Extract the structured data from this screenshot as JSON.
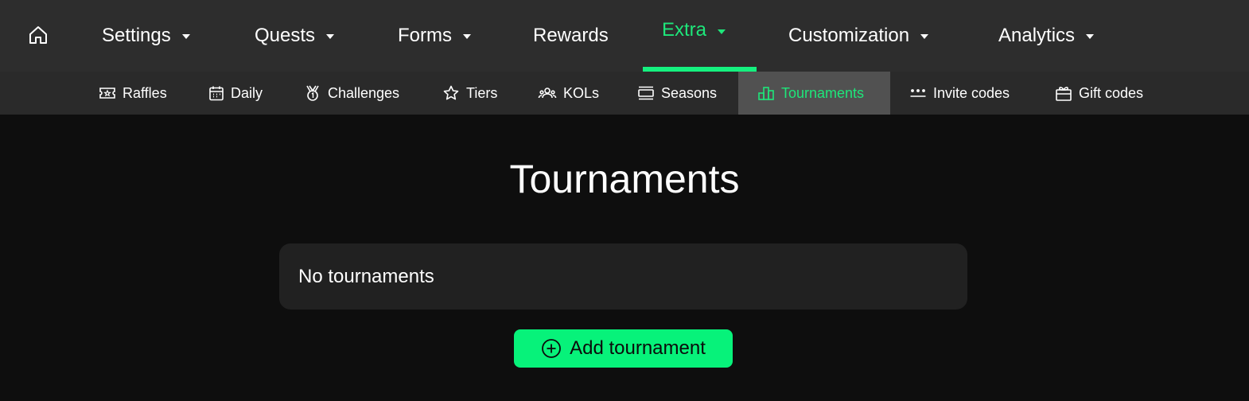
{
  "nav": {
    "home_icon": "home-icon",
    "items": [
      {
        "label": "Settings",
        "dropdown": true
      },
      {
        "label": "Quests",
        "dropdown": true
      },
      {
        "label": "Forms",
        "dropdown": true
      },
      {
        "label": "Rewards",
        "dropdown": false
      },
      {
        "label": "Extra",
        "dropdown": true,
        "active": true
      },
      {
        "label": "Customization",
        "dropdown": true
      },
      {
        "label": "Analytics",
        "dropdown": true
      }
    ]
  },
  "subnav": {
    "items": [
      {
        "label": "Raffles",
        "icon": "ticket-icon"
      },
      {
        "label": "Daily",
        "icon": "calendar-icon"
      },
      {
        "label": "Challenges",
        "icon": "medal-icon"
      },
      {
        "label": "Tiers",
        "icon": "star-icon"
      },
      {
        "label": "KOLs",
        "icon": "users-icon"
      },
      {
        "label": "Seasons",
        "icon": "seasons-icon"
      },
      {
        "label": "Tournaments",
        "icon": "podium-icon",
        "active": true
      },
      {
        "label": "Invite codes",
        "icon": "asterisks-icon"
      },
      {
        "label": "Gift codes",
        "icon": "gift-icon"
      }
    ]
  },
  "main": {
    "title": "Tournaments",
    "empty_text": "No tournaments",
    "add_button": "Add tournament"
  },
  "colors": {
    "accent": "#15f07f",
    "topnav_bg": "#2d2d2d",
    "subnav_bg": "#2a2a2a",
    "subnav_active_bg": "#515151",
    "page_bg": "#0e0e0e",
    "card_bg": "#212121"
  }
}
